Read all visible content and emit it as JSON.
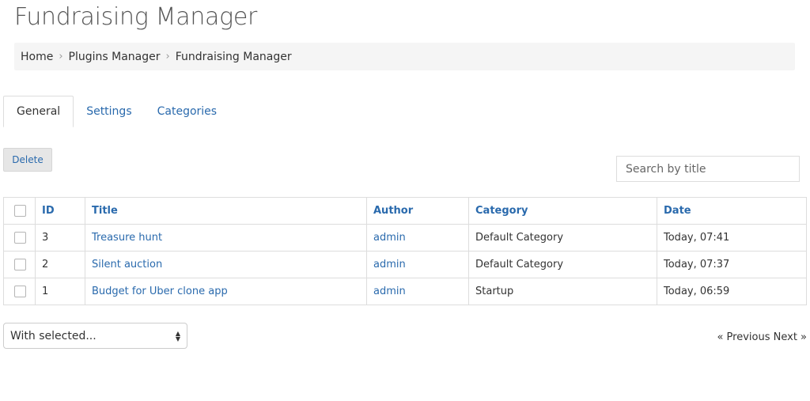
{
  "page": {
    "title": "Fundraising Manager"
  },
  "breadcrumb": {
    "items": [
      "Home",
      "Plugins Manager",
      "Fundraising Manager"
    ],
    "separator": "›"
  },
  "tabs": [
    {
      "label": "General",
      "active": true
    },
    {
      "label": "Settings",
      "active": false
    },
    {
      "label": "Categories",
      "active": false
    }
  ],
  "toolbar": {
    "delete_label": "Delete"
  },
  "search": {
    "placeholder": "Search by title",
    "value": ""
  },
  "table": {
    "headers": {
      "id": "ID",
      "title": "Title",
      "author": "Author",
      "category": "Category",
      "date": "Date"
    },
    "rows": [
      {
        "id": "3",
        "title": "Treasure hunt",
        "author": "admin",
        "category": "Default Category",
        "date": "Today, 07:41"
      },
      {
        "id": "2",
        "title": "Silent auction",
        "author": "admin",
        "category": "Default Category",
        "date": "Today, 07:37"
      },
      {
        "id": "1",
        "title": "Budget for Uber clone app",
        "author": "admin",
        "category": "Startup",
        "date": "Today, 06:59"
      }
    ]
  },
  "bulk_action": {
    "selected": "With selected..."
  },
  "pagination": {
    "previous": "« Previous",
    "next": "Next »"
  },
  "colors": {
    "link": "#2a6aad",
    "breadcrumb_bg": "#f5f5f5",
    "border": "#dddddd"
  }
}
